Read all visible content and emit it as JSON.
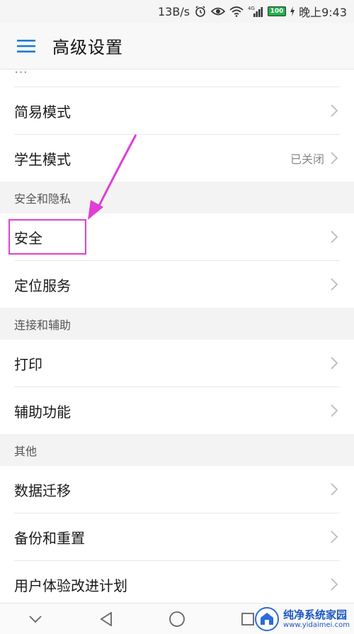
{
  "status_bar": {
    "net_speed": "13B/s",
    "network_type": "4G",
    "battery_level": "100",
    "time": "晚上9:43",
    "icons": [
      "alarm-icon",
      "eye-icon",
      "wifi-icon",
      "signal-icon",
      "battery-icon",
      "charging-icon"
    ]
  },
  "app_bar": {
    "title": "高级设置",
    "menu_icon": "hamburger-menu-icon"
  },
  "partial_row": {
    "label": "…"
  },
  "rows_top": [
    {
      "label": "简易模式",
      "value": ""
    },
    {
      "label": "学生模式",
      "value": "已关闭"
    }
  ],
  "sections": [
    {
      "header": "安全和隐私",
      "items": [
        {
          "label": "安全"
        },
        {
          "label": "定位服务"
        }
      ]
    },
    {
      "header": "连接和辅助",
      "items": [
        {
          "label": "打印"
        },
        {
          "label": "辅助功能"
        }
      ]
    },
    {
      "header": "其他",
      "items": [
        {
          "label": "数据迁移"
        },
        {
          "label": "备份和重置"
        },
        {
          "label": "用户体验改进计划"
        }
      ]
    }
  ],
  "annotation": {
    "color": "#e03fd6"
  },
  "nav_bar": {
    "icons": [
      "collapse-icon",
      "back-icon",
      "home-icon",
      "recents-icon"
    ]
  },
  "watermark": {
    "title": "纯净系统家园",
    "url": "www.yidaimei.com"
  }
}
